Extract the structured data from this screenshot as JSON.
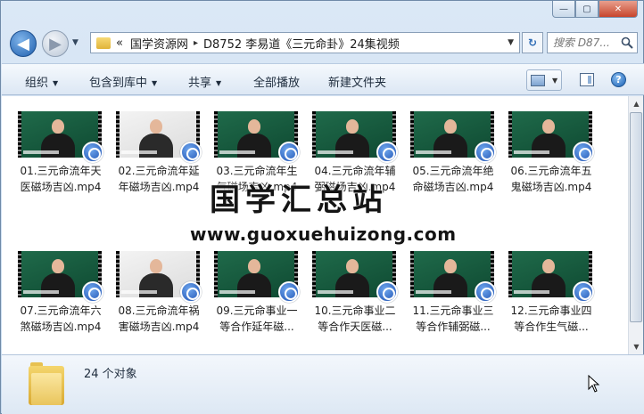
{
  "window": {
    "caption_buttons": {
      "minimize": "—",
      "maximize": "▢",
      "close": "✕"
    }
  },
  "nav": {
    "back": "◀",
    "forward": "▶",
    "dropdown": "▼",
    "breadcrumb_prefix": "«",
    "path": [
      "国学资源网",
      "D8752 李易道《三元命卦》24集视频"
    ],
    "separator": "▸",
    "refresh": "↻",
    "search_placeholder": "搜索 D87..."
  },
  "toolbar": {
    "organize": "组织",
    "include_in_library": "包含到库中",
    "share": "共享",
    "play_all": "全部播放",
    "new_folder": "新建文件夹",
    "arrow": "▼",
    "help": "?"
  },
  "files": [
    {
      "name": "01.三元命流年天医磁场吉凶.mp4",
      "line1": "01.三元命流年天",
      "line2": "医磁场吉凶.mp4",
      "style": "green"
    },
    {
      "name": "02.三元命流年延年磁场吉凶.mp4",
      "line1": "02.三元命流年延",
      "line2": "年磁场吉凶.mp4",
      "style": "white"
    },
    {
      "name": "03.三元命流年生气磁场吉凶.mp4",
      "line1": "03.三元命流年生",
      "line2": "气磁场吉凶.mp4",
      "style": "green"
    },
    {
      "name": "04.三元命流年辅弼磁场吉凶.mp4",
      "line1": "04.三元命流年辅",
      "line2": "弼磁场吉凶.mp4",
      "style": "green"
    },
    {
      "name": "05.三元命流年绝命磁场吉凶.mp4",
      "line1": "05.三元命流年绝",
      "line2": "命磁场吉凶.mp4",
      "style": "green"
    },
    {
      "name": "06.三元命流年五鬼磁场吉凶.mp4",
      "line1": "06.三元命流年五",
      "line2": "鬼磁场吉凶.mp4",
      "style": "green"
    },
    {
      "name": "07.三元命流年六煞磁场吉凶.mp4",
      "line1": "07.三元命流年六",
      "line2": "煞磁场吉凶.mp4",
      "style": "green"
    },
    {
      "name": "08.三元命流年祸害磁场吉凶.mp4",
      "line1": "08.三元命流年祸",
      "line2": "害磁场吉凶.mp4",
      "style": "white"
    },
    {
      "name": "09.三元命事业一等合作延年磁...",
      "line1": "09.三元命事业一",
      "line2": "等合作延年磁...",
      "style": "green"
    },
    {
      "name": "10.三元命事业二等合作天医磁...",
      "line1": "10.三元命事业二",
      "line2": "等合作天医磁...",
      "style": "green"
    },
    {
      "name": "11.三元命事业三等合作辅弼磁...",
      "line1": "11.三元命事业三",
      "line2": "等合作辅弼磁...",
      "style": "green"
    },
    {
      "name": "12.三元命事业四等合作生气磁...",
      "line1": "12.三元命事业四",
      "line2": "等合作生气磁...",
      "style": "green"
    }
  ],
  "watermark": {
    "title": "国学汇总站",
    "url": "www.guoxuehuizong.com"
  },
  "status": {
    "count": "24 个对象"
  },
  "scrollbar": {
    "up": "▲",
    "down": "▼"
  }
}
